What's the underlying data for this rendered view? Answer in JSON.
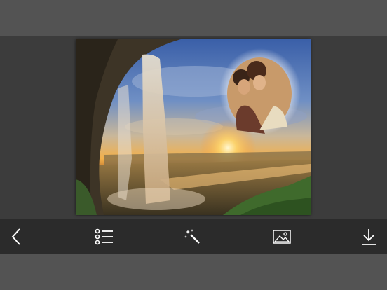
{
  "toolbar": {
    "items": [
      {
        "icon": "back-chevron-icon"
      },
      {
        "icon": "list-menu-icon"
      },
      {
        "icon": "magic-wand-icon"
      },
      {
        "icon": "gallery-image-icon"
      },
      {
        "icon": "download-icon"
      }
    ]
  },
  "photo": {
    "scene": "waterfall-sunset-frame",
    "overlay": "couple-portrait-oval"
  },
  "colors": {
    "background": "#444444",
    "top_band": "#535353",
    "toolbar": "#2b2b2b",
    "icon": "#ffffff"
  }
}
